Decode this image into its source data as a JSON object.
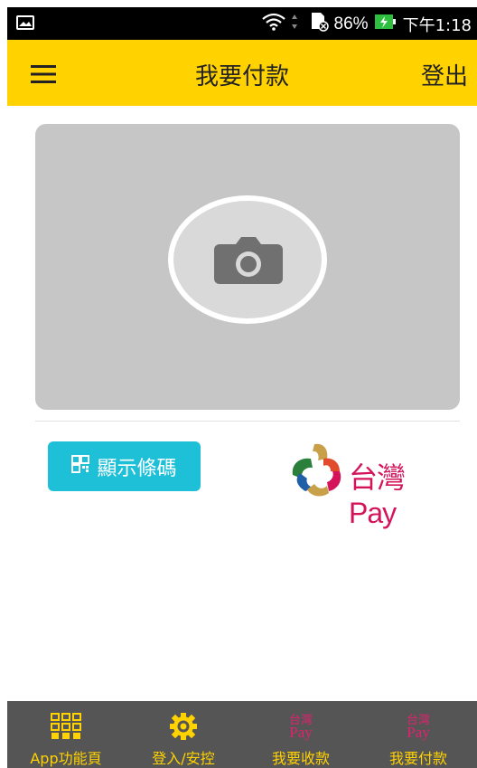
{
  "status_bar": {
    "battery": "86%",
    "time": "下午1:18"
  },
  "header": {
    "title": "我要付款",
    "logout_label": "登出"
  },
  "scanner": {
    "icon": "camera-icon"
  },
  "actions": {
    "show_barcode_label": "顯示條碼",
    "show_barcode_icon": "barcode-icon"
  },
  "brand": {
    "logo_text": "台灣Pay"
  },
  "bottom_nav": {
    "items": [
      {
        "label": "App功能頁",
        "icon": "grid-icon"
      },
      {
        "label": "登入/安控",
        "icon": "gear-icon"
      },
      {
        "label": "我要收款",
        "icon_top": "台灣",
        "icon_bottom": "Pay"
      },
      {
        "label": "我要付款",
        "icon_top": "台灣",
        "icon_bottom": "Pay"
      }
    ]
  },
  "colors": {
    "header_bg": "#ffd200",
    "button_bg": "#1ec0d8",
    "nav_bg": "#555555",
    "nav_label": "#ffd200",
    "pay_pink": "#e0226f"
  }
}
